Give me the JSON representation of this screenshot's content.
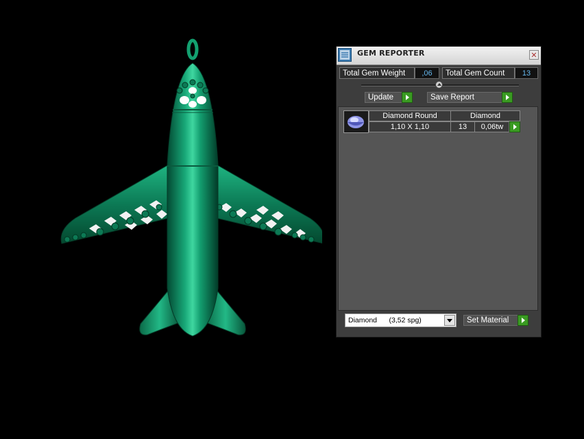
{
  "window": {
    "title": "GEM REPORTER",
    "close_glyph": "✕"
  },
  "stats": {
    "total_weight_label": "Total Gem Weight",
    "total_weight_value": ",06",
    "total_count_label": "Total Gem Count",
    "total_count_value": "13"
  },
  "buttons": {
    "update_label": "Update",
    "save_report_label": "Save Report",
    "set_material_label": "Set Material"
  },
  "gem_table": {
    "rows": [
      {
        "shape": "Diamond Round",
        "material": "Diamond",
        "size": "1,10 X 1,10",
        "count": "13",
        "weight": "0,06tw",
        "icon": "round-gem-icon"
      }
    ]
  },
  "material_select": {
    "selected": "Diamond      (3,52 spg)"
  },
  "colors": {
    "model_green": "#0e8a63",
    "accent_green": "#3a9a22",
    "value_blue": "#66b9f0",
    "panel_bg": "#3d3d3d"
  },
  "viewport": {
    "model": "airplane pendant with diamonds",
    "icon": "airplane-model"
  }
}
